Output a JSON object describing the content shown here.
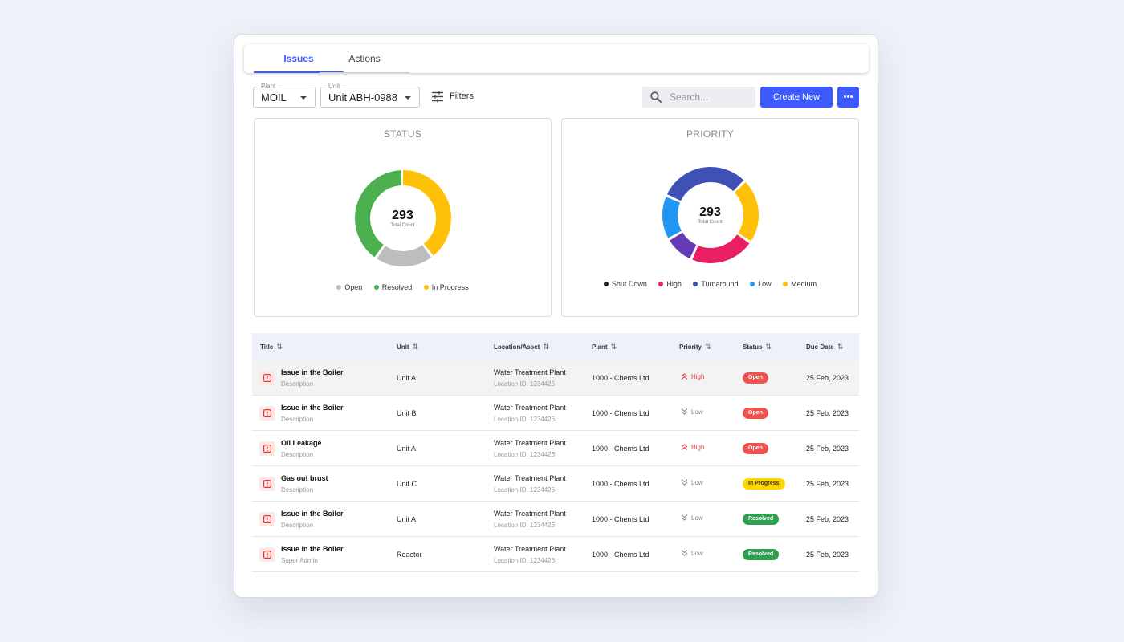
{
  "tabs": [
    {
      "label": "Issues",
      "active": true
    },
    {
      "label": "Actions",
      "active": false
    }
  ],
  "filters": {
    "plant": {
      "label": "Plant",
      "value": "MOIL"
    },
    "unit": {
      "label": "Unit",
      "value": "Unit ABH-0988"
    },
    "filters_label": "Filters"
  },
  "search": {
    "placeholder": "Search..."
  },
  "create_button": "Create New",
  "status_chart": {
    "title": "STATUS",
    "total": "293",
    "total_label": "Total Count",
    "legend": [
      {
        "label": "Open",
        "color": "#bdbdbd"
      },
      {
        "label": "Resolved",
        "color": "#4caf50"
      },
      {
        "label": "In Progress",
        "color": "#ffc107"
      }
    ]
  },
  "priority_chart": {
    "title": "PRIORITY",
    "total": "293",
    "total_label": "Total Count",
    "legend": [
      {
        "label": "Shut Down",
        "color": "#212121"
      },
      {
        "label": "High",
        "color": "#e91e63"
      },
      {
        "label": "Turnaround",
        "color": "#3f51b5"
      },
      {
        "label": "Low",
        "color": "#2196f3"
      },
      {
        "label": "Medium",
        "color": "#ffc107"
      }
    ]
  },
  "table": {
    "columns": [
      "Title",
      "Unit",
      "Location/Asset",
      "Plant",
      "Priority",
      "Status",
      "Due Date"
    ],
    "rows": [
      {
        "title": "Issue in the Boiler",
        "subtitle": "Description",
        "unit": "Unit A",
        "location": "Water Treatment Plant",
        "location_id": "Location ID: 1234426",
        "plant": "1000 - Chems Ltd",
        "priority": "High",
        "status": "Open",
        "due": "25 Feb, 2023"
      },
      {
        "title": "Issue in the Boiler",
        "subtitle": "Description",
        "unit": "Unit B",
        "location": "Water Treatment Plant",
        "location_id": "Location ID: 1234426",
        "plant": "1000 - Chems Ltd",
        "priority": "Low",
        "status": "Open",
        "due": "25 Feb, 2023"
      },
      {
        "title": "Oil Leakage",
        "subtitle": "Description",
        "unit": "Unit A",
        "location": "Water Treatment Plant",
        "location_id": "Location ID: 1234426",
        "plant": "1000 - Chems Ltd",
        "priority": "High",
        "status": "Open",
        "due": "25 Feb, 2023"
      },
      {
        "title": "Gas out brust",
        "subtitle": "Description",
        "unit": "Unit C",
        "location": "Water Treatment Plant",
        "location_id": "Location ID: 1234426",
        "plant": "1000 - Chems Ltd",
        "priority": "Low",
        "status": "In Progress",
        "due": "25 Feb, 2023"
      },
      {
        "title": "Issue in the Boiler",
        "subtitle": "Description",
        "unit": "Unit A",
        "location": "Water Treatment Plant",
        "location_id": "Location ID: 1234426",
        "plant": "1000 - Chems Ltd",
        "priority": "Low",
        "status": "Resolved",
        "due": "25 Feb, 2023"
      },
      {
        "title": "Issue in the Boiler",
        "subtitle": "Super Admin",
        "unit": "Reactor",
        "location": "Water Treatment Plant",
        "location_id": "Location ID: 1234426",
        "plant": "1000 - Chems Ltd",
        "priority": "Low",
        "status": "Resolved",
        "due": "25 Feb, 2023"
      }
    ]
  },
  "colors": {
    "accent": "#3d5afe",
    "priority_high": "#e53935",
    "priority_low": "#888888",
    "status_open": "#ef5350",
    "status_in_progress": "#ffd600",
    "status_resolved": "#2e9e4f"
  },
  "icons": [
    "filter-sliders-icon",
    "search-icon",
    "more-dots-icon",
    "sort-icon",
    "alert-icon",
    "chevron-double-up-icon",
    "chevron-double-down-icon"
  ]
}
